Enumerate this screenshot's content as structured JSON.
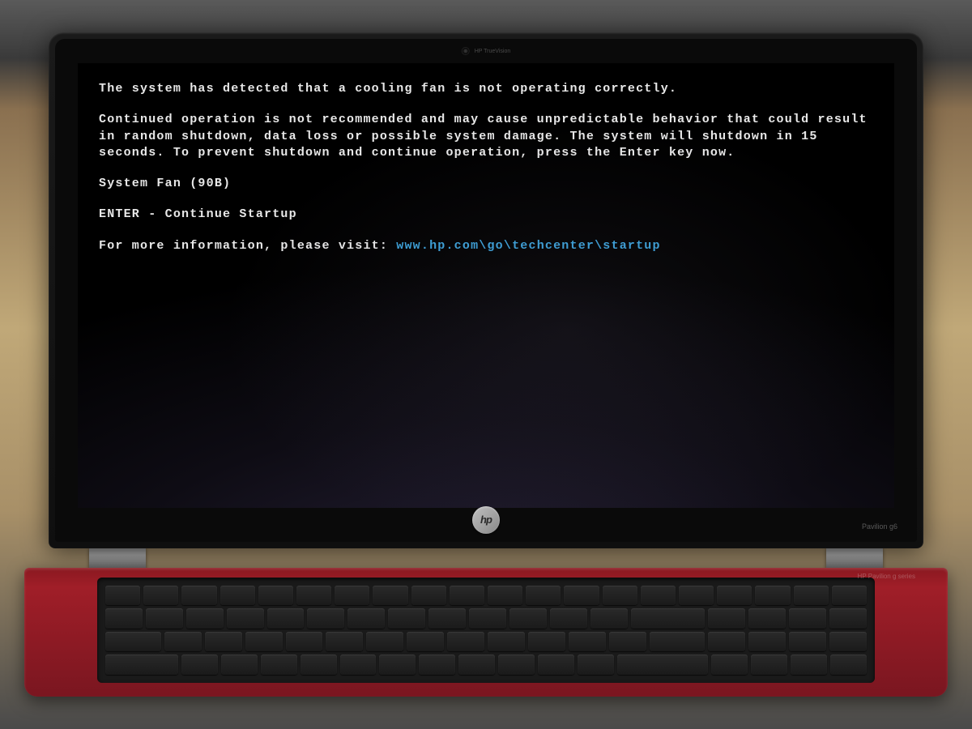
{
  "bios": {
    "heading": "The system has detected that a cooling fan is not operating correctly.",
    "body": "Continued operation is not recommended and may cause unpredictable behavior that could result in random shutdown, data loss or possible system damage. The system will shutdown in 15 seconds. To prevent shutdown and continue operation, press the Enter key now.",
    "error_code": "System Fan (90B)",
    "action": "ENTER - Continue Startup",
    "info_prefix": "For more information, please visit: ",
    "info_url": "www.hp.com\\go\\techcenter\\startup"
  },
  "hardware": {
    "brand": "hp",
    "webcam_label": "HP TrueVision",
    "model_label": "Pavilion g6",
    "base_label": "HP Pavilion g series"
  }
}
